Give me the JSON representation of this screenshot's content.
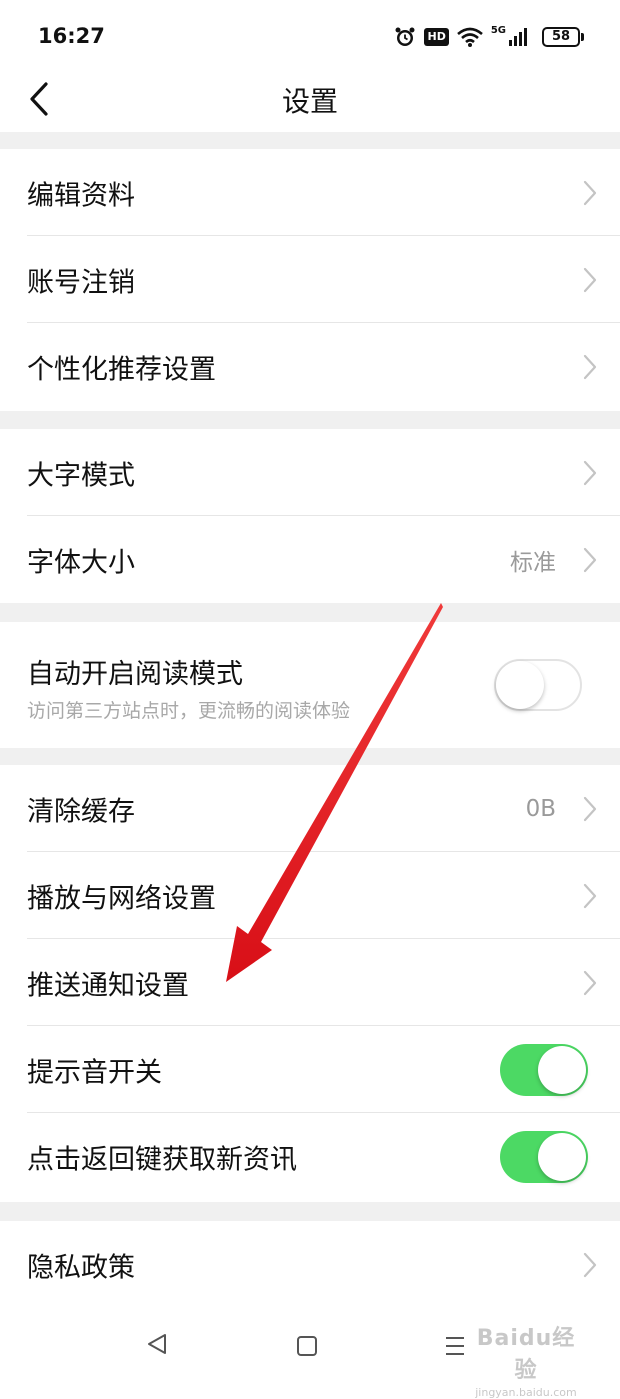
{
  "status_bar": {
    "time": "16:27",
    "hd_badge": "HD",
    "network": "5G",
    "battery": "58"
  },
  "header": {
    "title": "设置"
  },
  "groups": [
    {
      "items": [
        {
          "label": "编辑资料",
          "type": "link"
        },
        {
          "label": "账号注销",
          "type": "link"
        },
        {
          "label": "个性化推荐设置",
          "type": "link"
        }
      ]
    },
    {
      "items": [
        {
          "label": "大字模式",
          "type": "link"
        },
        {
          "label": "字体大小",
          "type": "link",
          "value": "标准"
        }
      ]
    },
    {
      "items": [
        {
          "label": "自动开启阅读模式",
          "subtitle": "访问第三方站点时，更流畅的阅读体验",
          "type": "toggle",
          "enabled": false
        }
      ]
    },
    {
      "items": [
        {
          "label": "清除缓存",
          "type": "link",
          "value": "0B"
        },
        {
          "label": "播放与网络设置",
          "type": "link"
        },
        {
          "label": "推送通知设置",
          "type": "link"
        },
        {
          "label": "提示音开关",
          "type": "toggle",
          "enabled": true
        },
        {
          "label": "点击返回键获取新资讯",
          "type": "toggle",
          "enabled": true
        }
      ]
    },
    {
      "items": [
        {
          "label": "隐私政策",
          "type": "link"
        }
      ]
    }
  ],
  "watermark": {
    "main": "Baidu经验",
    "sub": "jingyan.baidu.com"
  },
  "colors": {
    "toggle_on": "#4cd964",
    "section_gap": "#f0f0f0",
    "annotation_arrow": "#e8141c"
  },
  "icons": {
    "back": "chevron-left-icon",
    "row_arrow": "chevron-right-icon",
    "nav_back": "triangle-back-icon",
    "nav_home": "square-home-icon",
    "nav_menu": "menu-lines-icon"
  }
}
